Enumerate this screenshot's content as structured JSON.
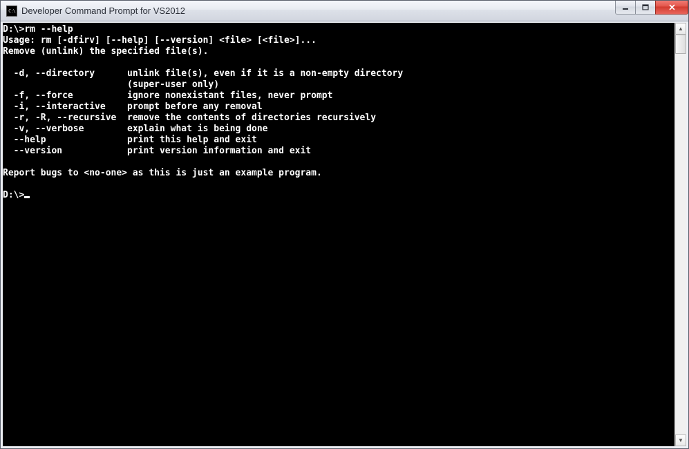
{
  "window": {
    "title": "Developer Command Prompt for VS2012",
    "icon_label": "C:\\"
  },
  "terminal": {
    "prompt1": "D:\\>",
    "command1": "rm --help",
    "usage": "Usage: rm [-dfirv] [--help] [--version] <file> [<file>]...",
    "desc": "Remove (unlink) the specified file(s).",
    "opts": [
      {
        "flag": "  -d, --directory      ",
        "text": "unlink file(s), even if it is a non-empty directory"
      },
      {
        "flag": "                       ",
        "text": "(super-user only)"
      },
      {
        "flag": "  -f, --force          ",
        "text": "ignore nonexistant files, never prompt"
      },
      {
        "flag": "  -i, --interactive    ",
        "text": "prompt before any removal"
      },
      {
        "flag": "  -r, -R, --recursive  ",
        "text": "remove the contents of directories recursively"
      },
      {
        "flag": "  -v, --verbose        ",
        "text": "explain what is being done"
      },
      {
        "flag": "  --help               ",
        "text": "print this help and exit"
      },
      {
        "flag": "  --version            ",
        "text": "print version information and exit"
      }
    ],
    "report": "Report bugs to <no-one> as this is just an example program.",
    "prompt2": "D:\\>"
  }
}
